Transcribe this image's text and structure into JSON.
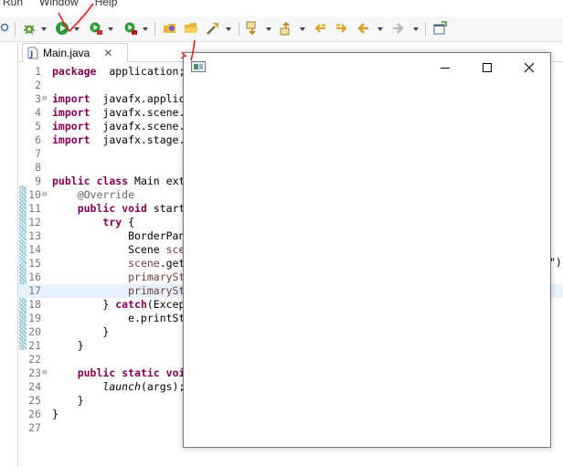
{
  "menubar": {
    "items": [
      "Run",
      "Window",
      "Help"
    ]
  },
  "toolbar": {
    "buttons": [
      "debug-icon",
      "run-icon",
      "coverage-icon",
      "external-tools-icon",
      "new-package-icon",
      "open-folder-icon",
      "build-icon",
      "next-annotation-icon",
      "previous-annotation-icon",
      "last-edit-icon",
      "edit-forward-icon",
      "back-icon",
      "forward-icon",
      "open-perspective-icon"
    ]
  },
  "editor": {
    "tab": {
      "label": "Main.java",
      "close": "✕"
    },
    "lines": [
      {
        "n": "1",
        "fold": "",
        "parts": [
          [
            "kw",
            "package"
          ],
          [
            "",
            "  application;"
          ]
        ]
      },
      {
        "n": "2",
        "fold": "",
        "parts": []
      },
      {
        "n": "3",
        "fold": "⊖",
        "parts": [
          [
            "kw",
            "import"
          ],
          [
            "",
            "  javafx.applica"
          ]
        ]
      },
      {
        "n": "4",
        "fold": "",
        "parts": [
          [
            "kw",
            "import"
          ],
          [
            "",
            "  javafx.scene.S"
          ]
        ]
      },
      {
        "n": "5",
        "fold": "",
        "parts": [
          [
            "kw",
            "import"
          ],
          [
            "",
            "  javafx.scene.l"
          ]
        ]
      },
      {
        "n": "6",
        "fold": "",
        "parts": [
          [
            "kw",
            "import"
          ],
          [
            "",
            "  javafx.stage.S"
          ]
        ]
      },
      {
        "n": "7",
        "fold": "",
        "parts": []
      },
      {
        "n": "8",
        "fold": "",
        "parts": []
      },
      {
        "n": "9",
        "fold": "",
        "parts": [
          [
            "kw",
            "public"
          ],
          [
            "",
            " "
          ],
          [
            "kw",
            "class"
          ],
          [
            "",
            " Main ext"
          ]
        ]
      },
      {
        "n": "10",
        "fold": "⊖",
        "parts": [
          [
            "",
            "    "
          ],
          [
            "ann",
            "@Override"
          ]
        ]
      },
      {
        "n": "11",
        "fold": "",
        "parts": [
          [
            "",
            "    "
          ],
          [
            "kw",
            "public"
          ],
          [
            "",
            " "
          ],
          [
            "kw",
            "void"
          ],
          [
            "",
            " start"
          ]
        ]
      },
      {
        "n": "12",
        "fold": "",
        "parts": [
          [
            "",
            "        "
          ],
          [
            "kw",
            "try"
          ],
          [
            "",
            " {"
          ]
        ]
      },
      {
        "n": "13",
        "fold": "",
        "parts": [
          [
            "",
            "            BorderPan"
          ]
        ]
      },
      {
        "n": "14",
        "fold": "",
        "parts": [
          [
            "",
            "            Scene "
          ],
          [
            "var",
            "sce"
          ]
        ]
      },
      {
        "n": "15",
        "fold": "",
        "parts": [
          [
            "",
            "            "
          ],
          [
            "var",
            "scene"
          ],
          [
            "",
            ".get"
          ]
        ]
      },
      {
        "n": "16",
        "fold": "",
        "parts": [
          [
            "",
            "            "
          ],
          [
            "var",
            "primarySt"
          ]
        ]
      },
      {
        "n": "17",
        "fold": "",
        "parts": [
          [
            "",
            "            "
          ],
          [
            "var",
            "primarySt"
          ]
        ]
      },
      {
        "n": "18",
        "fold": "",
        "parts": [
          [
            "",
            "        } "
          ],
          [
            "kw",
            "catch"
          ],
          [
            "",
            "(Excep"
          ]
        ]
      },
      {
        "n": "19",
        "fold": "",
        "parts": [
          [
            "",
            "            e.printSt"
          ]
        ]
      },
      {
        "n": "20",
        "fold": "",
        "parts": [
          [
            "",
            "        }"
          ]
        ]
      },
      {
        "n": "21",
        "fold": "",
        "parts": [
          [
            "",
            "    }"
          ]
        ]
      },
      {
        "n": "22",
        "fold": "",
        "parts": []
      },
      {
        "n": "23",
        "fold": "⊖",
        "parts": [
          [
            "",
            "    "
          ],
          [
            "kw",
            "public"
          ],
          [
            "",
            " "
          ],
          [
            "kw",
            "static"
          ],
          [
            "",
            " "
          ],
          [
            "kw",
            "voi"
          ]
        ]
      },
      {
        "n": "24",
        "fold": "",
        "parts": [
          [
            "",
            "        "
          ],
          [
            "it",
            "launch"
          ],
          [
            "",
            "(args);"
          ]
        ]
      },
      {
        "n": "25",
        "fold": "",
        "parts": [
          [
            "",
            "    }"
          ]
        ]
      },
      {
        "n": "26",
        "fold": "",
        "parts": [
          [
            "",
            "}"
          ]
        ]
      },
      {
        "n": "27",
        "fold": "",
        "parts": []
      }
    ],
    "line15_tail": "\")",
    "highlighted_line": 17
  },
  "window": {
    "buttons": {
      "minimize": "minimize-icon",
      "maximize": "maximize-icon",
      "close": "close-icon"
    }
  },
  "colors": {
    "keyword": "#7f0055",
    "annotation": "#646464",
    "variable": "#6a3e3e",
    "highlight": "#e8f2fe",
    "red_mark": "#e02020"
  }
}
